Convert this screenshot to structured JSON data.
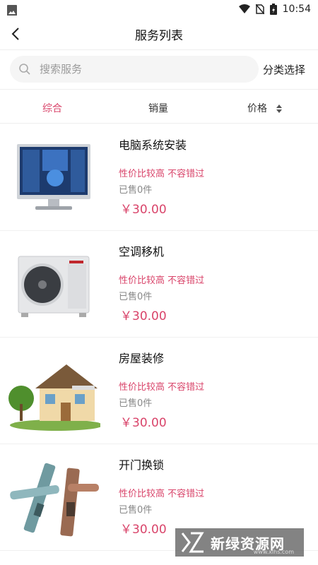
{
  "status_bar": {
    "time": "10:54"
  },
  "nav": {
    "title": "服务列表"
  },
  "search": {
    "placeholder": "搜索服务",
    "category_label": "分类选择"
  },
  "sort_tabs": [
    {
      "label": "综合",
      "active": true
    },
    {
      "label": "销量",
      "active": false
    },
    {
      "label": "价格",
      "active": false
    }
  ],
  "items": [
    {
      "name": "电脑系统安装",
      "slogan": "性价比较高 不容错过",
      "sold": "已售0件",
      "price": "￥30.00",
      "image": "computer-monitor"
    },
    {
      "name": "空调移机",
      "slogan": "性价比较高 不容错过",
      "sold": "已售0件",
      "price": "￥30.00",
      "image": "ac-outdoor-unit"
    },
    {
      "name": "房屋装修",
      "slogan": "性价比较高 不容错过",
      "sold": "已售0件",
      "price": "￥30.00",
      "image": "house"
    },
    {
      "name": "开门换锁",
      "slogan": "性价比较高 不容错过",
      "sold": "已售0件",
      "price": "￥30.00",
      "image": "door-lock"
    }
  ],
  "watermark": {
    "text": "新绿资源网",
    "sub": "www.xlhs.com"
  },
  "colors": {
    "accent": "#d9446a",
    "search_bg": "#f5f5f5"
  }
}
